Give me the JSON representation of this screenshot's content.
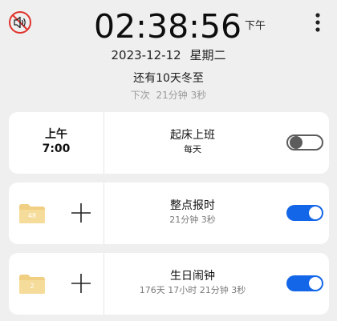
{
  "header": {
    "mute_icon": "speaker-muted-icon",
    "menu_icon": "more-vertical-icon",
    "time": "02:38:56",
    "ampm": "下午",
    "date": "2023-12-12",
    "weekday": "星期二",
    "countdown": "还有10天冬至",
    "next_label": "下次",
    "next_minutes": "21分钟",
    "next_seconds": "3秒"
  },
  "colors": {
    "accent": "#1366e8",
    "background": "#efefef",
    "card": "#ffffff",
    "folder": "#f3d58f"
  },
  "alarms": [
    {
      "period": "上午",
      "time": "7:00",
      "title": "起床上班",
      "subtitle": "每天",
      "enabled": false
    },
    {
      "folder_count": "48",
      "title": "整点报时",
      "subtitle": "21分钟 3秒",
      "enabled": true
    },
    {
      "folder_count": "2",
      "title": "生日闹钟",
      "subtitle": "176天 17小时 21分钟 3秒",
      "enabled": true
    }
  ]
}
